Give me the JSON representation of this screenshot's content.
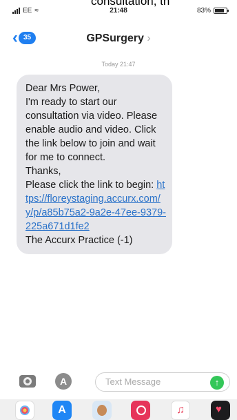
{
  "overlay_text": "consultation, th",
  "status_bar": {
    "carrier": "EE",
    "time": "21:48",
    "battery": "83%",
    "battery_level": 0.83
  },
  "nav": {
    "back_count": "35",
    "contact_name": "GPSurgery",
    "contact_chevron": "›"
  },
  "timestamp": "Today 21:47",
  "message": {
    "text_before_link": "Dear Mrs Power,\nI'm ready to start our consultation via video. Please enable audio and video. Click the link below to join and wait for me to connect.\nThanks,\nPlease click the link to begin: ",
    "link": "https://floreystaging.accurx.com/y/p/a85b75a2-9a2e-47ee-9379-225a671d1fe2",
    "signature": "The Accurx Practice (-1)"
  },
  "composer": {
    "placeholder": "Text Message",
    "send_icon": "arrow-up-icon",
    "camera_icon": "camera-icon",
    "apps_icon": "app-store-icon"
  },
  "app_strip": [
    "photos-icon",
    "app-store-icon",
    "memoji-icon",
    "image-search-icon",
    "music-icon",
    "digital-touch-icon"
  ],
  "colors": {
    "accent": "#1f7ff0",
    "bubble": "#e6e6ea",
    "link": "#2a72c9",
    "send": "#34c759"
  }
}
